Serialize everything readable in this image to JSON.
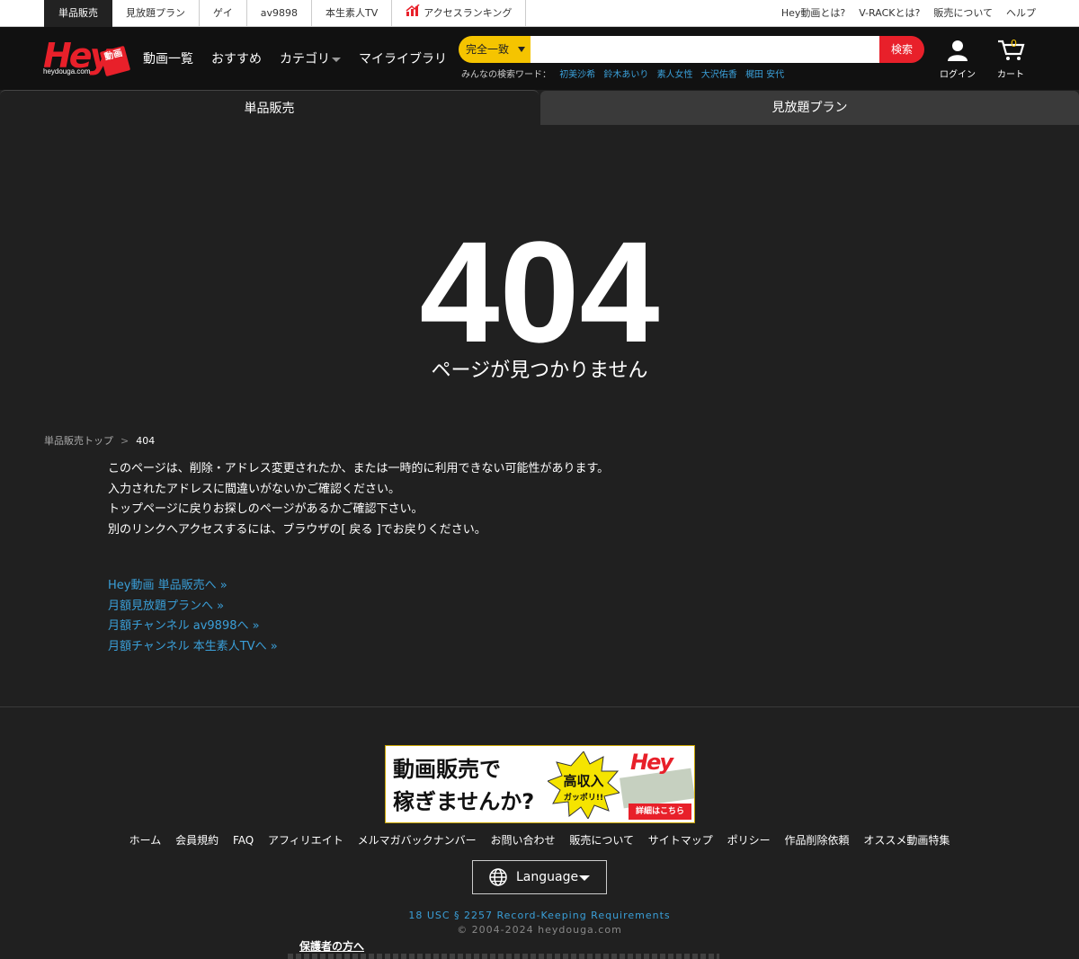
{
  "topbar": {
    "tabs": [
      "単品販売",
      "見放題プラン",
      "ゲイ",
      "av9898",
      "本生素人TV",
      "アクセスランキング"
    ],
    "links": [
      "Hey動画とは?",
      "V-RACKとは?",
      "販売について",
      "ヘルプ"
    ]
  },
  "logo": {
    "text": "Hey",
    "badge": "動画",
    "domain": "heydouga.com"
  },
  "nav": {
    "items": [
      "動画一覧",
      "おすすめ",
      "カテゴリ",
      "マイライブラリ"
    ]
  },
  "search": {
    "mode": "完全一致",
    "value": "",
    "button": "検索",
    "popular_label": "みんなの検索ワード：",
    "popular": [
      "初美沙希",
      "鈴木あいり",
      "素人女性",
      "大沢佑香",
      "梶田 安代"
    ]
  },
  "account": {
    "login": "ログイン",
    "cart": "カート",
    "cart_count": "0"
  },
  "plan_tabs": {
    "single": "単品販売",
    "unlimited": "見放題プラン"
  },
  "error": {
    "code": "404",
    "message": "ページが見つかりません"
  },
  "breadcrumb": {
    "home": "単品販売トップ",
    "sep": ">",
    "current": "404"
  },
  "explain": [
    "このページは、削除・アドレス変更されたか、または一時的に利用できない可能性があります。",
    "入力されたアドレスに間違いがないかご確認ください。",
    "トップページに戻りお探しのページがあるかご確認下さい。",
    "別のリンクへアクセスするには、ブラウザの[ 戻る ]でお戻りください。"
  ],
  "links": [
    "Hey動画 単品販売へ »",
    "月額見放題プランへ »",
    "月額チャンネル av9898へ »",
    "月額チャンネル 本生素人TVへ »"
  ],
  "banner": {
    "line1": "動画販売で",
    "line2": "稼ぎませんか?",
    "burst": "高収入",
    "burst_sub": "ガッポリ!!",
    "logo": "Hey",
    "cta": "詳細はこちら"
  },
  "footer": {
    "nav": [
      "ホーム",
      "会員規約",
      "FAQ",
      "アフィリエイト",
      "メルマガバックナンバー",
      "お問い合わせ",
      "販売について",
      "サイトマップ",
      "ポリシー",
      "作品削除依頼",
      "オススメ動画特集"
    ],
    "language": "Language",
    "record": "18 USC § 2257 Record-Keeping Requirements",
    "copyright": "© 2004-2024 heydouga.com",
    "parents": "保護者の方へ"
  },
  "colors": {
    "accent_red": "#e8202a",
    "accent_yellow": "#f5c400",
    "link_blue": "#3a9fd8",
    "bg": "#202020"
  }
}
